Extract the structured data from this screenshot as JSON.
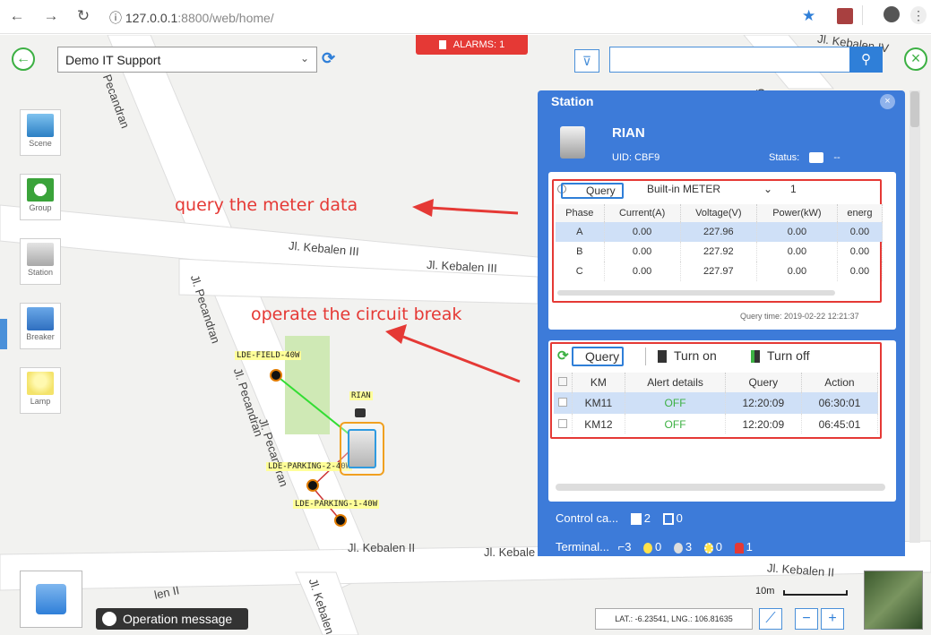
{
  "browser": {
    "url_host": "127.0.0.1",
    "url_rest": ":8800/web/home/",
    "info_icon": "ⓘ"
  },
  "toolbar": {
    "org_value": "Demo IT Support",
    "alarm_label": "ALARMS: 1",
    "search_placeholder": ""
  },
  "tools": [
    {
      "label": "Scene"
    },
    {
      "label": "Group"
    },
    {
      "label": "Station"
    },
    {
      "label": "Breaker"
    },
    {
      "label": "Lamp"
    }
  ],
  "map": {
    "streets": {
      "pecandran_top": "Pecandran",
      "kebalen_iv": "Jl. Kebalen IV",
      "kebalen_iii_a": "Jl. Kebalen III",
      "kebalen_iii_b": "Jl. Kebalen III",
      "pecandran_diag": "Jl. Pecandran",
      "pecandran_diag2": "Jl. Pecandran",
      "pecandran_diag3": "Jl. Pecandran",
      "kebalen_ii_a": "Jl. Kebalen II",
      "kebalen_ii_b": "Jl. Kebale",
      "kebalen_ii_c": "Jl. Kebalen II",
      "kebalen_ii_d": "Jl. Kebalen II",
      "kebalen_bottom": "Jl. Kebalen",
      "g_fragment": "g",
      "frag_bottom": "len II"
    },
    "devices": {
      "field": "LDE-FIELD-40W",
      "parking2": "LDE-PARKING-2-40W",
      "parking1": "LDE-PARKING-1-40W",
      "station": "RIAN"
    },
    "scale": "10m",
    "coords": "LAT.: -6.23541, LNG.: 106.81635",
    "op_message": "Operation message"
  },
  "annotations": {
    "meter": "query the meter data",
    "breaker": "operate the circuit break"
  },
  "panel": {
    "title": "Station",
    "station_name": "RIAN",
    "uid_label": "UID:",
    "uid_value": "CBF9",
    "status_label": "Status:",
    "status_value": "--",
    "meter": {
      "query_label": "Query",
      "meter_type": "Built-in METER",
      "meter_index": "1",
      "headers": [
        "Phase",
        "Current(A)",
        "Voltage(V)",
        "Power(kW)",
        "energ"
      ],
      "rows": [
        {
          "phase": "A",
          "current": "0.00",
          "voltage": "227.96",
          "power": "0.00",
          "energy": "0.00"
        },
        {
          "phase": "B",
          "current": "0.00",
          "voltage": "227.92",
          "power": "0.00",
          "energy": "0.00"
        },
        {
          "phase": "C",
          "current": "0.00",
          "voltage": "227.97",
          "power": "0.00",
          "energy": "0.00"
        }
      ],
      "query_time_label": "Query time:",
      "query_time_value": "2019-02-22 12:21:37"
    },
    "breaker": {
      "query_label": "Query",
      "turn_on": "Turn on",
      "turn_off": "Turn off",
      "headers": [
        "KM",
        "Alert details",
        "Query",
        "Action"
      ],
      "rows": [
        {
          "km": "KM11",
          "alert": "OFF",
          "query": "12:20:09",
          "action": "06:30:01"
        },
        {
          "km": "KM12",
          "alert": "OFF",
          "query": "12:20:09",
          "action": "06:45:01"
        }
      ]
    },
    "control_label": "Control ca...",
    "control_counts": {
      "breakers": "2",
      "meters": "0"
    },
    "terminal_label": "Terminal...",
    "terminal_counts": {
      "poles": "3",
      "lamp_on": "0",
      "lamp_off": "3",
      "lamp_fault": "0",
      "alarm": "1"
    }
  },
  "colors": {
    "panel_blue": "#3d7bd9",
    "accent_green": "#3cb043",
    "alarm_red": "#e53935",
    "annotation_red": "#e53935"
  }
}
